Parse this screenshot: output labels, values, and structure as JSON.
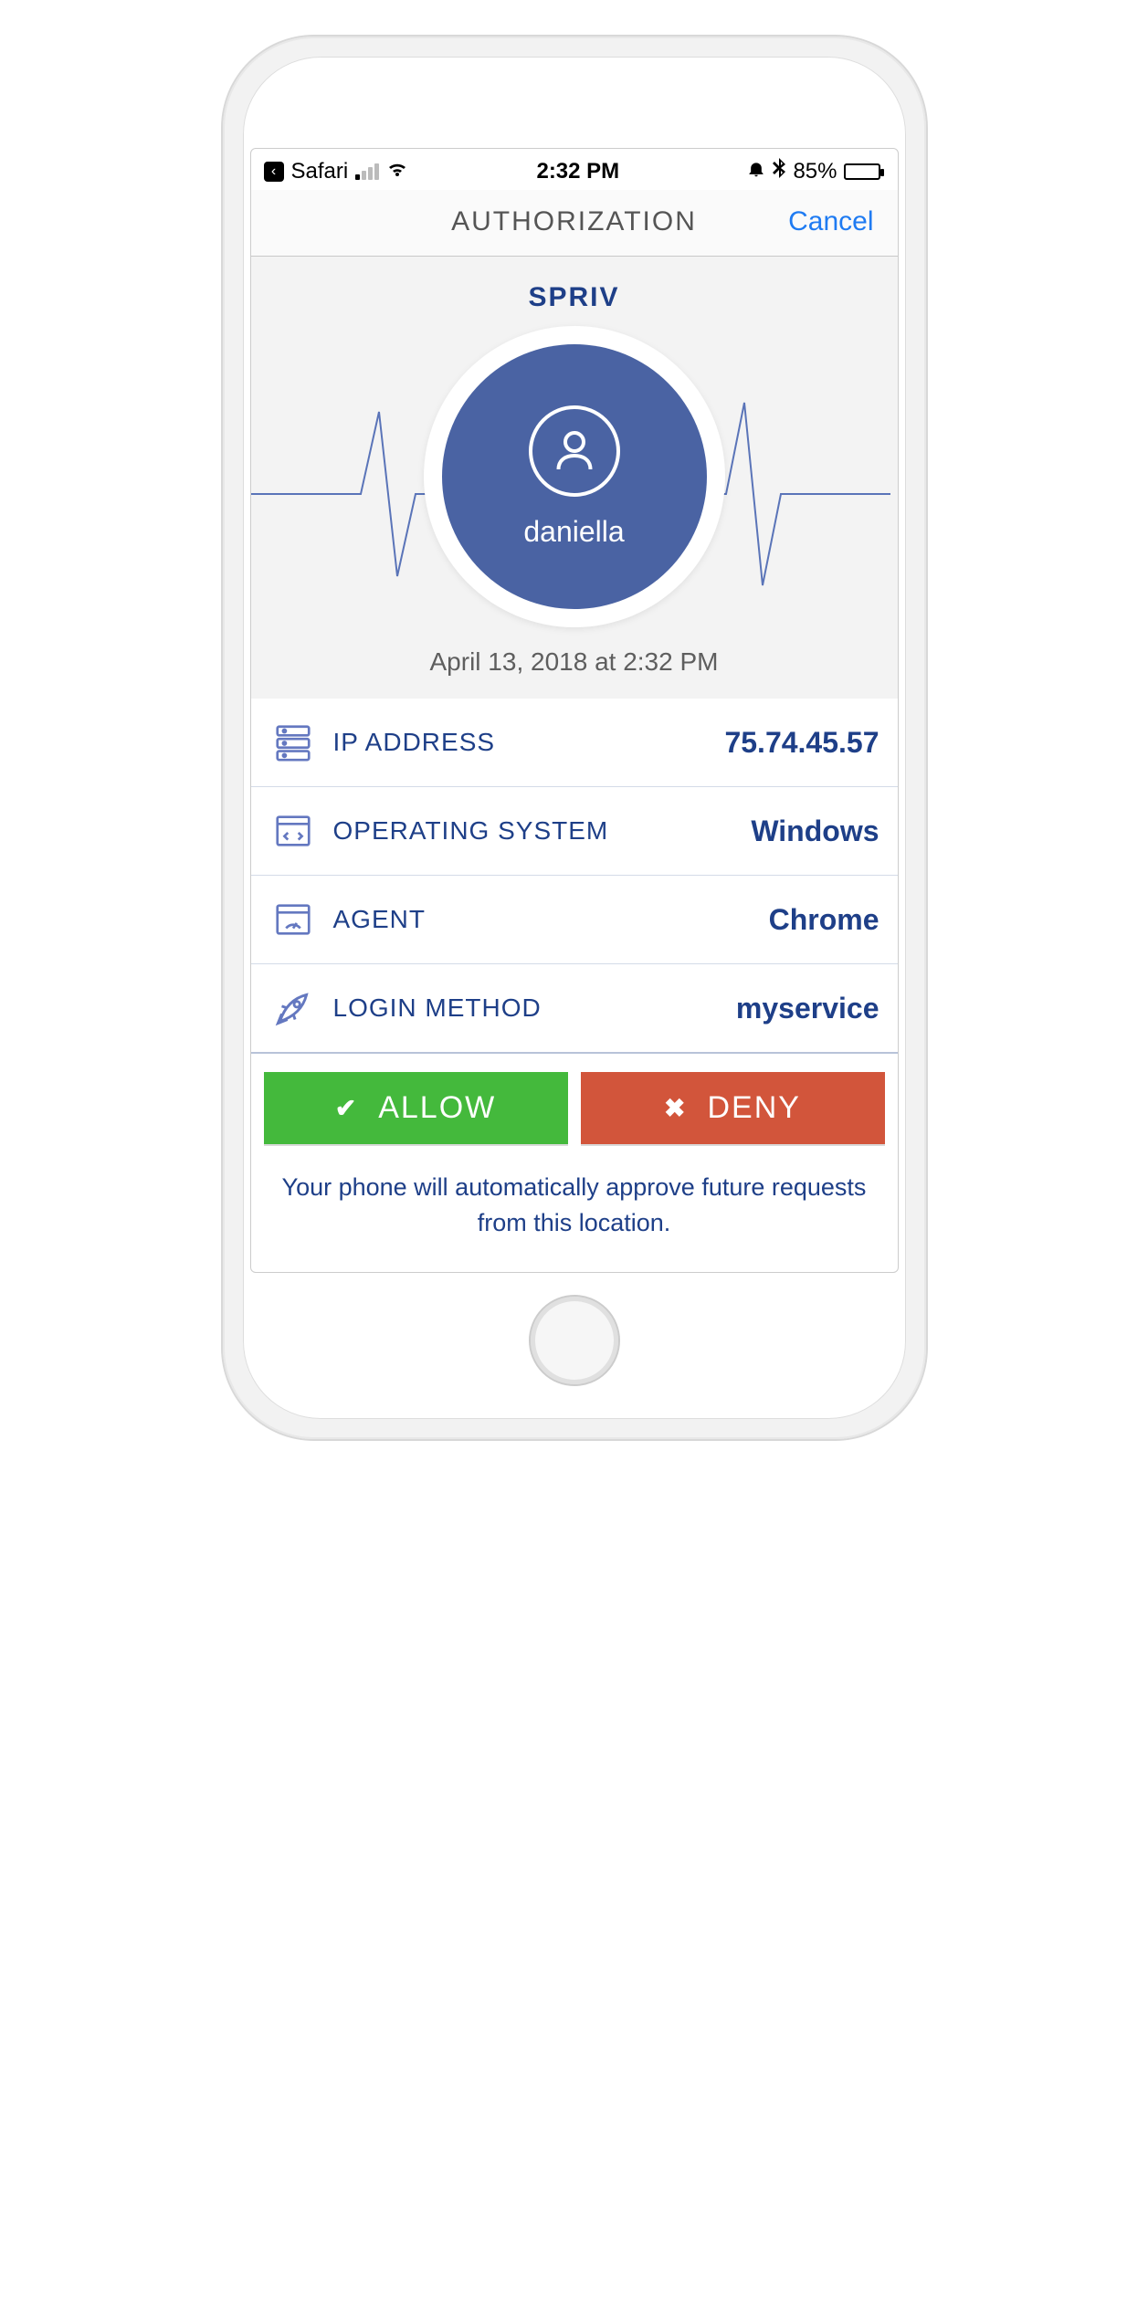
{
  "status_bar": {
    "back_app": "Safari",
    "time": "2:32 PM",
    "battery_percent": "85%"
  },
  "nav": {
    "title": "AUTHORIZATION",
    "cancel": "Cancel"
  },
  "hero": {
    "brand": "SPRIV",
    "username": "daniella",
    "timestamp": "April 13, 2018 at 2:32 PM"
  },
  "details": {
    "ip_label": "IP ADDRESS",
    "ip_value": "75.74.45.57",
    "os_label": "OPERATING SYSTEM",
    "os_value": "Windows",
    "agent_label": "AGENT",
    "agent_value": "Chrome",
    "login_label": "LOGIN METHOD",
    "login_value": "myservice"
  },
  "actions": {
    "allow": "ALLOW",
    "deny": "DENY"
  },
  "footer": "Your phone will automatically approve future requests from this location."
}
